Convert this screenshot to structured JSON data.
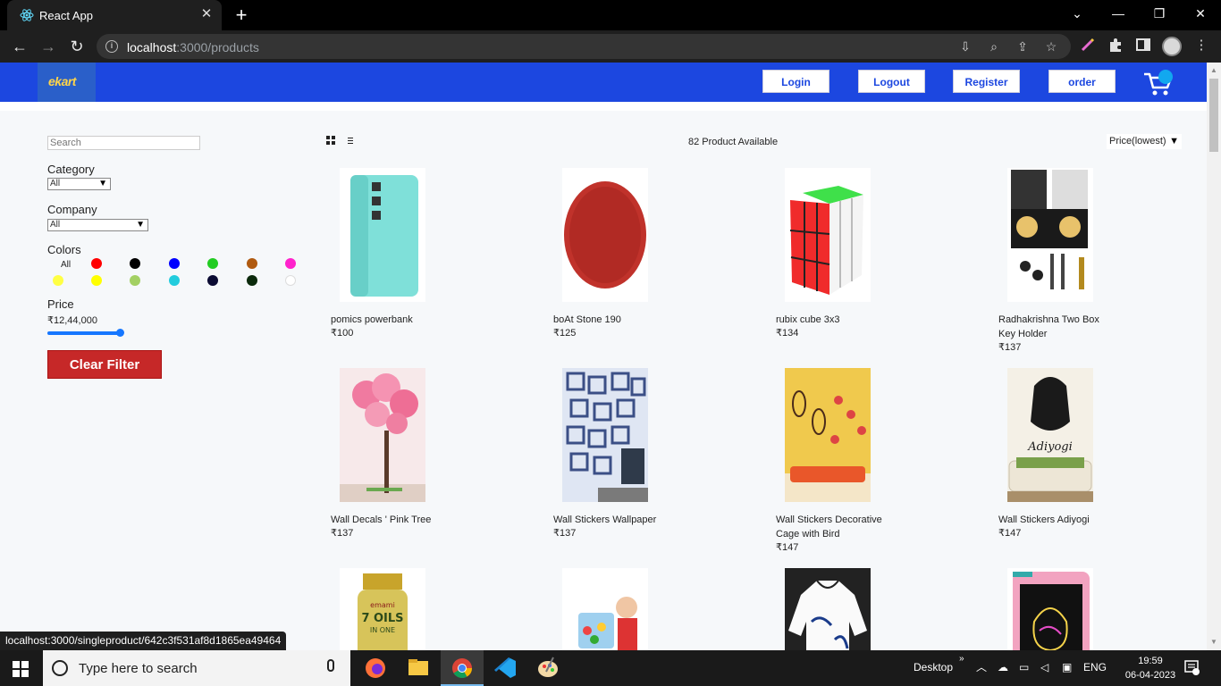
{
  "browser": {
    "tab_title": "React App",
    "close_glyph": "✕",
    "new_tab_glyph": "+",
    "url_host": "localhost",
    "url_rest": ":3000/products",
    "window_controls": [
      "⌄",
      "—",
      "❐",
      "✕"
    ]
  },
  "header": {
    "logo": "ekart",
    "nav": [
      "Login",
      "Logout",
      "Register",
      "order"
    ]
  },
  "filters": {
    "search_placeholder": "Search",
    "category_label": "Category",
    "category_value": "All",
    "company_label": "Company",
    "company_value": "All",
    "colors_label": "Colors",
    "colors_all": "All",
    "colors": [
      "#ff0000",
      "#000000",
      "#0000ff",
      "#22cc22",
      "#b05a10",
      "#ff22cc",
      "#ffff44",
      "#ffff00",
      "#a3d063",
      "#22ccdd",
      "#0b0b33",
      "#0b2a0b",
      "#ffffff"
    ],
    "price_label": "Price",
    "price_value": "₹12,44,000",
    "price_level": 1.0,
    "clear_button": "Clear Filter"
  },
  "products_bar": {
    "count_text": "82 Product Available",
    "sort_value": "Price(lowest)"
  },
  "products": [
    {
      "name": "pomics powerbank",
      "price": "₹100"
    },
    {
      "name": "boAt Stone 190",
      "price": "₹125"
    },
    {
      "name": "rubix cube 3x3",
      "price": "₹134"
    },
    {
      "name": "Radhakrishna Two Box Key Holder",
      "price": "₹137"
    },
    {
      "name": "Wall Decals ' Pink Tree",
      "price": "₹137"
    },
    {
      "name": "Wall Stickers Wallpaper",
      "price": "₹137"
    },
    {
      "name": "Wall Stickers Decorative Cage with Bird",
      "price": "₹147"
    },
    {
      "name": "Wall Stickers Adiyogi",
      "price": "₹147"
    }
  ],
  "image_text": {
    "oil_brand": "emami",
    "oil_line1": "7 OILS",
    "oil_line2": "IN ONE",
    "adiyogi": "Adiyogi"
  },
  "status_bar": {
    "url": "localhost:3000/singleproduct/642c3f531af8d1865ea49464"
  },
  "taskbar": {
    "search_placeholder": "Type here to search",
    "desktop": "Desktop",
    "lang": "ENG",
    "time": "19:59",
    "date": "06-04-2023"
  }
}
